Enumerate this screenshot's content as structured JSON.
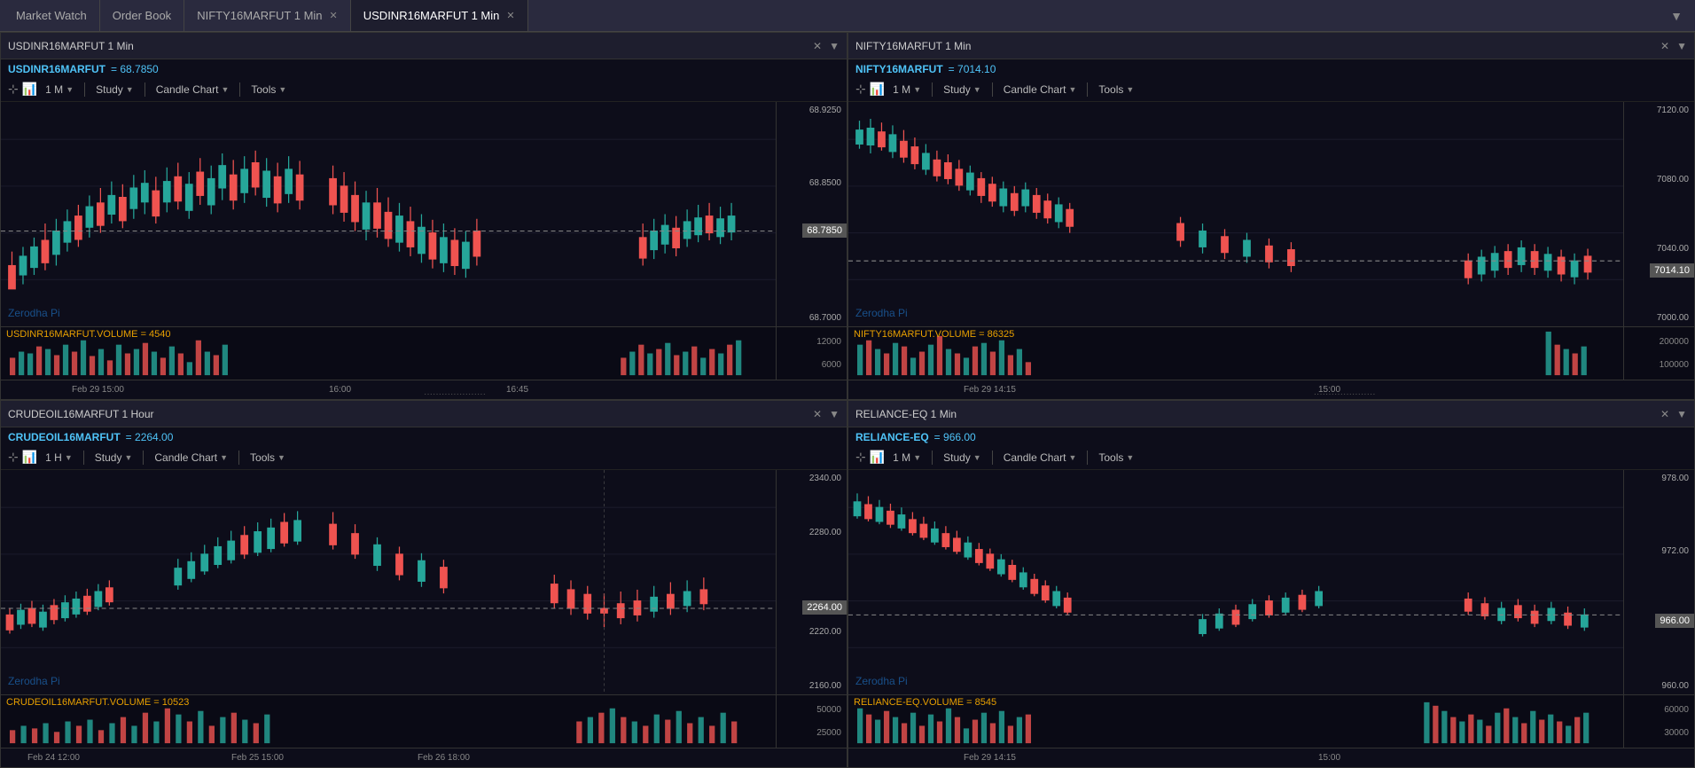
{
  "tabs": [
    {
      "label": "Market Watch",
      "active": false,
      "closable": false,
      "id": "market-watch"
    },
    {
      "label": "Order Book",
      "active": false,
      "closable": false,
      "id": "order-book"
    },
    {
      "label": "NIFTY16MARFUT 1 Min",
      "active": false,
      "closable": true,
      "id": "nifty-tab"
    },
    {
      "label": "USDINR16MARFUT 1 Min",
      "active": true,
      "closable": true,
      "id": "usdinr-tab"
    }
  ],
  "panels": [
    {
      "id": "panel-tl",
      "header": "USDINR16MARFUT 1 Min",
      "symbol": "USDINR16MARFUT",
      "price": "= 68.7850",
      "timeframe": "1 M",
      "current_price": "68.7850",
      "watermark": "Zerodha Pi",
      "volume_label": "USDINR16MARFUT.VOLUME = 4540",
      "price_levels": [
        "68.9250",
        "68.8500",
        "68.7850",
        "68.7000"
      ],
      "volume_levels": [
        "12000",
        "6000"
      ],
      "time_labels": [
        "Feb 29 15:00",
        "16:00",
        "16:45"
      ],
      "position": "top-left",
      "candles": "usdinr"
    },
    {
      "id": "panel-tr",
      "header": "NIFTY16MARFUT 1 Min",
      "symbol": "NIFTY16MARFUT",
      "price": "= 7014.10",
      "timeframe": "1 M",
      "current_price": "7014.10",
      "watermark": "Zerodha Pi",
      "volume_label": "NIFTY16MARFUT.VOLUME = 86325",
      "price_levels": [
        "7120.00",
        "7080.00",
        "7040.00",
        "7014.10",
        "7000.00"
      ],
      "volume_levels": [
        "200000",
        "100000"
      ],
      "time_labels": [
        "Feb 29 14:15",
        "15:00"
      ],
      "position": "top-right",
      "candles": "nifty"
    },
    {
      "id": "panel-bl",
      "header": "CRUDEOIL16MARFUT 1 Hour",
      "symbol": "CRUDEOIL16MARFUT",
      "price": "= 2264.00",
      "timeframe": "1 H",
      "current_price": "2264.00",
      "watermark": "Zerodha Pi",
      "volume_label": "CRUDEOIL16MARFUT.VOLUME = 10523",
      "price_levels": [
        "2340.00",
        "2280.00",
        "2264.00",
        "2220.00",
        "2160.00"
      ],
      "volume_levels": [
        "50000",
        "25000"
      ],
      "time_labels": [
        "Feb 24 12:00",
        "Feb 25 15:00",
        "Feb 26 18:00"
      ],
      "position": "bottom-left",
      "candles": "crude"
    },
    {
      "id": "panel-br",
      "header": "RELIANCE-EQ 1 Min",
      "symbol": "RELIANCE-EQ",
      "price": "= 966.00",
      "timeframe": "1 M",
      "current_price": "966.00",
      "watermark": "Zerodha Pi",
      "volume_label": "RELIANCE-EQ.VOLUME = 8545",
      "price_levels": [
        "978.00",
        "972.00",
        "966.00",
        "960.00"
      ],
      "volume_levels": [
        "60000",
        "30000"
      ],
      "time_labels": [
        "Feb 29 14:15",
        "15:00"
      ],
      "position": "bottom-right",
      "candles": "reliance"
    }
  ],
  "toolbar": {
    "study_label": "Study",
    "candle_chart_label": "Candle Chart",
    "tools_label": "Tools"
  }
}
